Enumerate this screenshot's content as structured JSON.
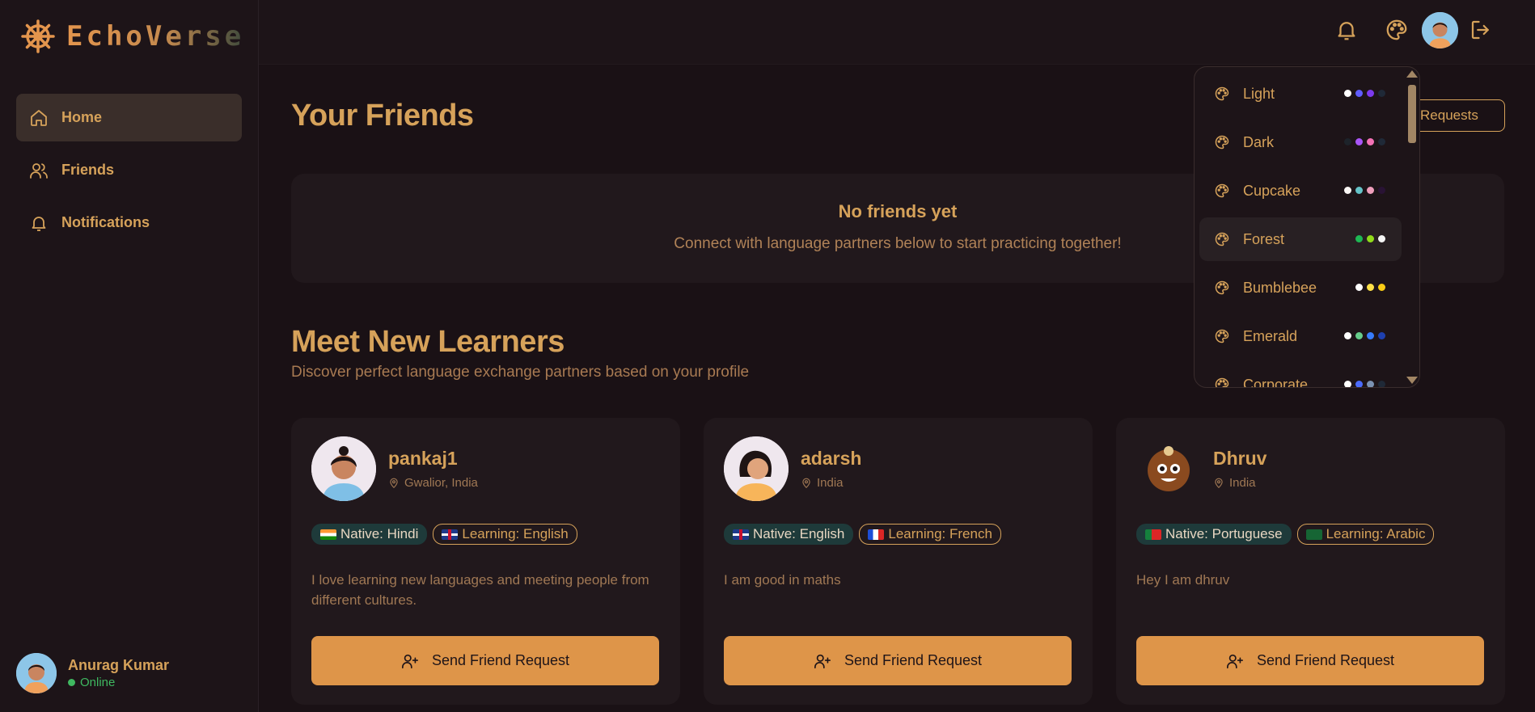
{
  "app": {
    "name": "EchoVerse"
  },
  "sidebar": {
    "items": [
      {
        "label": "Home",
        "icon": "home-icon",
        "active": true
      },
      {
        "label": "Friends",
        "icon": "users-icon",
        "active": false
      },
      {
        "label": "Notifications",
        "icon": "bell-icon",
        "active": false
      }
    ],
    "user": {
      "name": "Anurag Kumar",
      "status": "Online"
    }
  },
  "topbar": {
    "icons": [
      "bell-icon",
      "palette-icon",
      "avatar",
      "logout-icon"
    ]
  },
  "friends": {
    "title": "Your Friends",
    "requests_button": "Friend Requests",
    "empty_title": "No friends yet",
    "empty_subtitle": "Connect with language partners below to start practicing together!"
  },
  "learners": {
    "title": "Meet New Learners",
    "subtitle": "Discover perfect language exchange partners based on your profile",
    "cards": [
      {
        "name": "pankaj1",
        "location": "Gwalior, India",
        "native": "Native: Hindi",
        "learning": "Learning: English",
        "bio": "I love learning new languages and meeting people from different cultures.",
        "button": "Send Friend Request"
      },
      {
        "name": "adarsh",
        "location": "India",
        "native": "Native: English",
        "learning": "Learning: French",
        "bio": "I am good in maths",
        "button": "Send Friend Request"
      },
      {
        "name": "Dhruv",
        "location": "India",
        "native": "Native: Portuguese",
        "learning": "Learning: Arabic",
        "bio": "Hey I am dhruv",
        "button": "Send Friend Request"
      }
    ]
  },
  "theme_menu": {
    "items": [
      {
        "label": "Light",
        "colors": [
          "#ffffff",
          "#605dff",
          "#7c3aed",
          "#1f2937"
        ]
      },
      {
        "label": "Dark",
        "colors": [
          "#1d232a",
          "#a855f7",
          "#f472b6",
          "#1f2937"
        ]
      },
      {
        "label": "Cupcake",
        "colors": [
          "#faf7f5",
          "#65c3c8",
          "#ef9fbc",
          "#291334"
        ]
      },
      {
        "label": "Forest",
        "colors": [
          "#1eb854",
          "#91db1a",
          "#f5f5f5"
        ],
        "selected": true
      },
      {
        "label": "Bumblebee",
        "colors": [
          "#ffffff",
          "#fde047",
          "#facc15"
        ]
      },
      {
        "label": "Emerald",
        "colors": [
          "#ffffff",
          "#66cc8a",
          "#377cfb",
          "#1e40af"
        ]
      },
      {
        "label": "Corporate",
        "colors": [
          "#ffffff",
          "#4b6bfb",
          "#7b92b2",
          "#1f2937"
        ]
      }
    ]
  },
  "colors": {
    "accent": "#de9549",
    "background": "#1a1115",
    "text": "#d6a25a",
    "online": "#3fb860"
  }
}
